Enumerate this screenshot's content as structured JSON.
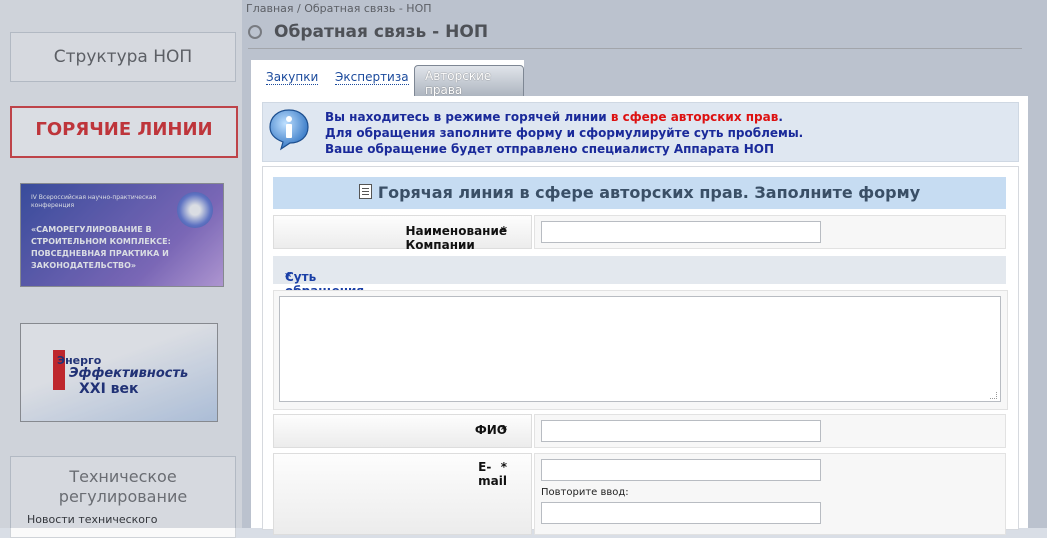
{
  "breadcrumb": {
    "home": "Главная",
    "separator": "/",
    "current": "Обратная связь - НОП"
  },
  "page": {
    "title": "Обратная связь - НОП"
  },
  "sidebar": {
    "structure": "Структура НОП",
    "hotlines": "ГОРЯЧИЕ ЛИНИИ",
    "banner1": {
      "line1": "IV Всероссийская научно-практическая конференция",
      "line2": "«САМОРЕГУЛИРОВАНИЕ В СТРОИТЕЛЬНОМ КОМПЛЕКСЕ: ПОВСЕДНЕВНАЯ ПРАКТИКА И ЗАКОНОДАТЕЛЬСТВО»"
    },
    "banner2": {
      "w1": "Энерго",
      "w2": "Эффективность",
      "w3": "XXI век"
    },
    "tech": {
      "title": "Техническое регулирование",
      "item": "Новости технического"
    }
  },
  "tabs": [
    {
      "label": "Закупки",
      "active": false
    },
    {
      "label": "Экспертиза",
      "active": false
    },
    {
      "label": "Авторские права",
      "active": true
    }
  ],
  "info": {
    "line1_a": "Вы находитесь в режиме горячей линии ",
    "line1_b": "в сфере авторских прав",
    "line1_c": ".",
    "line2": "Для обращения заполните форму и сформулируйте суть проблемы.",
    "line3": "Ваше обращение будет отправлено специалисту Аппарата НОП",
    "icon": "info-icon",
    "accent_color": "#d11111"
  },
  "form": {
    "title": "Горячая линия в сфере авторских прав. Заполните форму",
    "required_mark": "*",
    "company_label": "Наименование Компании",
    "company_value": "",
    "topic_label": "Суть обращения",
    "topic_value": "",
    "fio_label": "ФИО",
    "fio_value": "",
    "email_label": "E-mail",
    "email_value": "",
    "repeat_label": "Повторите ввод:",
    "repeat_value": ""
  }
}
